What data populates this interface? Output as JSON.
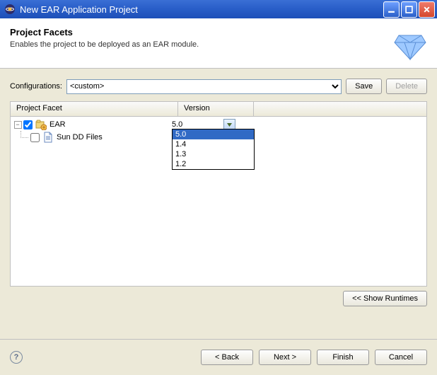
{
  "window": {
    "title": "New EAR Application Project"
  },
  "header": {
    "title": "Project Facets",
    "subtitle": "Enables the project to be deployed as an EAR module."
  },
  "config": {
    "label": "Configurations:",
    "selected": "<custom>",
    "save_label": "Save",
    "delete_label": "Delete"
  },
  "facets": {
    "col_facet": "Project Facet",
    "col_version": "Version",
    "rows": [
      {
        "name": "EAR",
        "version": "5.0",
        "checked": true
      },
      {
        "name": "Sun DD Files",
        "version": "",
        "checked": false
      }
    ]
  },
  "version_dropdown": {
    "options": [
      "5.0",
      "1.4",
      "1.3",
      "1.2"
    ],
    "selected": "5.0"
  },
  "show_runtimes_label": "<< Show Runtimes",
  "footer": {
    "back": "< Back",
    "next": "Next >",
    "finish": "Finish",
    "cancel": "Cancel"
  },
  "chart_data": null
}
